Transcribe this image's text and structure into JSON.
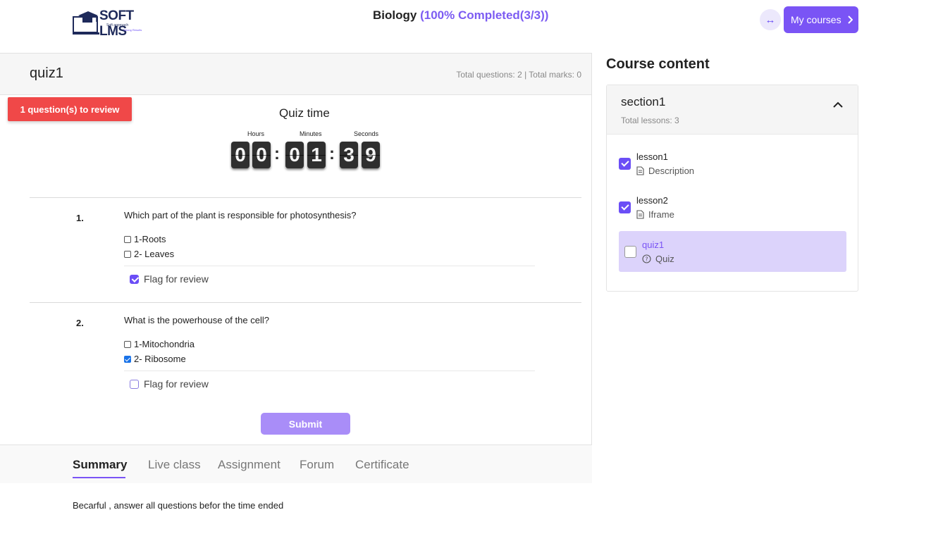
{
  "header": {
    "logo_text": "SOFT LMS",
    "logo_sub1": "Soft approach",
    "logo_sub2": "Strong Results",
    "course_name": "Biology",
    "course_progress": "(100% Completed(3/3))",
    "my_courses_label": "My courses",
    "toggle_icon": "↔"
  },
  "quiz": {
    "name": "quiz1",
    "meta": "Total questions: 2 | Total marks: 0",
    "review_badge": "1 question(s) to review",
    "timer_title": "Quiz time",
    "timer_labels": {
      "hours": "Hours",
      "minutes": "Minutes",
      "seconds": "Seconds"
    },
    "timer_digits": [
      "0",
      "0",
      "0",
      "1",
      "3",
      "9"
    ],
    "questions": [
      {
        "number": "1.",
        "text": "Which part of the plant is responsible for photosynthesis?",
        "options": [
          {
            "label": "1-Roots",
            "checked": false
          },
          {
            "label": "2- Leaves",
            "checked": false
          }
        ],
        "flag_label": "Flag for review",
        "flagged": true
      },
      {
        "number": "2.",
        "text": "What is the powerhouse of the cell?",
        "options": [
          {
            "label": "1-Mitochondria",
            "checked": false
          },
          {
            "label": "2- Ribosome",
            "checked": true
          }
        ],
        "flag_label": "Flag for review",
        "flagged": false
      }
    ],
    "submit_label": "Submit"
  },
  "tabs": [
    {
      "label": "Summary",
      "active": true
    },
    {
      "label": "Live class",
      "active": false
    },
    {
      "label": "Assignment",
      "active": false
    },
    {
      "label": "Forum",
      "active": false
    },
    {
      "label": "Certificate",
      "active": false
    }
  ],
  "summary_text": "Becarful , answer all questions befor the time ended",
  "sidebar": {
    "title": "Course content",
    "section": {
      "name": "section1",
      "sub": "Total lessons: 3",
      "lessons": [
        {
          "name": "lesson1",
          "type": "Description",
          "checked": true,
          "active": false,
          "icon": "document-icon"
        },
        {
          "name": "lesson2",
          "type": "Iframe",
          "checked": true,
          "active": false,
          "icon": "document-icon"
        },
        {
          "name": "quiz1",
          "type": "Quiz",
          "checked": false,
          "active": true,
          "icon": "question-icon"
        }
      ]
    }
  },
  "colors": {
    "accent": "#7a54f5",
    "badge": "#f04848",
    "active_lesson_bg": "#dcd3fb"
  }
}
